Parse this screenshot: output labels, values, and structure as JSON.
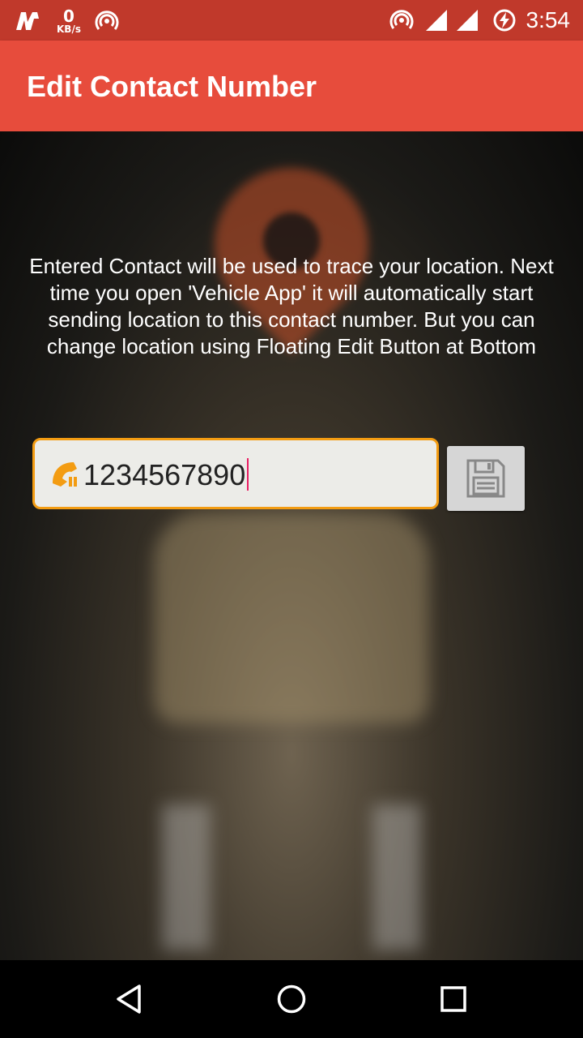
{
  "status_bar": {
    "data_rate_value": "0",
    "data_rate_unit": "KB/s",
    "time": "3:54"
  },
  "app_bar": {
    "title": "Edit Contact Number"
  },
  "main": {
    "description": "Entered Contact will be used to trace your location. Next time you open 'Vehicle App' it will automatically start sending location to this contact number. But you can change location using Floating Edit Button at Bottom",
    "phone_input": {
      "value": "1234567890",
      "icon": "phone-icon"
    },
    "save_button": {
      "icon": "floppy-disk-icon"
    }
  },
  "colors": {
    "status_bar": "#c0392b",
    "app_bar": "#e74c3c",
    "input_border": "#f39c12",
    "caret": "#e91e63",
    "phone_icon": "#f39c12"
  },
  "nav_bar": {
    "icons": [
      "back-icon",
      "home-icon",
      "recents-icon"
    ]
  }
}
